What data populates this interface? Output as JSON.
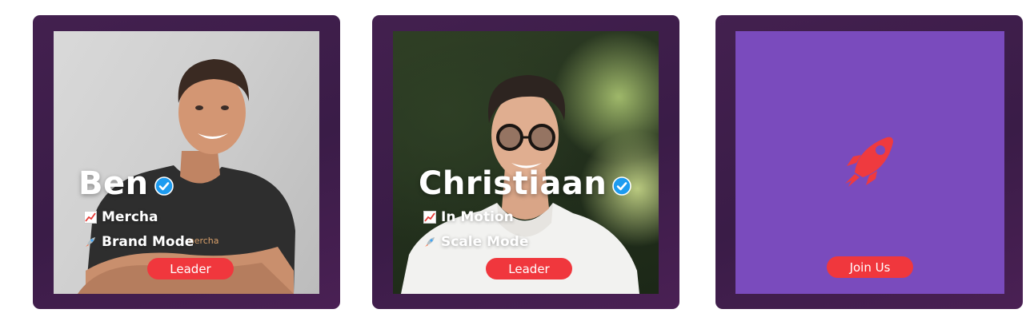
{
  "cards": [
    {
      "name": "Ben",
      "line1": "Mercha",
      "line2": "Brand Mode",
      "button": "Leader",
      "shirt_text": "mercha"
    },
    {
      "name": "Christiaan",
      "line1": "In Motion",
      "line2": "Scale Mode",
      "button": "Leader"
    },
    {
      "button": "Join Us"
    }
  ],
  "icons": {
    "verified": "verified-badge-icon",
    "chart": "chart-increasing-icon",
    "rocket": "rocket-icon"
  },
  "colors": {
    "card_frame": "#43204f",
    "pill": "#f0373d",
    "join_bg": "#7a4bbd",
    "verified": "#1d9bf0",
    "rocket": "#ef3a3f"
  }
}
